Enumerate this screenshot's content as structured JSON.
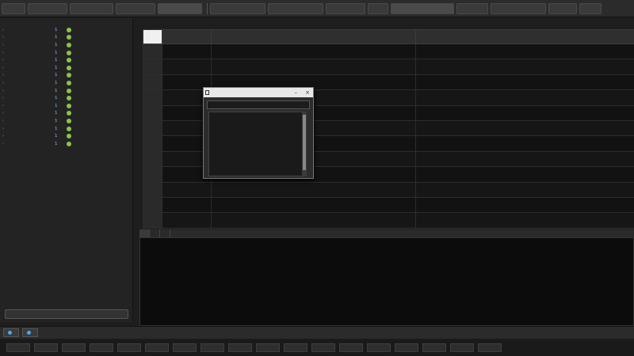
{
  "toolbar": {
    "buttons": [
      "",
      "",
      "",
      "",
      "",
      "",
      "",
      "",
      "",
      "",
      "",
      ""
    ],
    "right_buttons": [
      "",
      "",
      ""
    ]
  },
  "sidebar": {
    "items": [
      {
        "name": "",
        "num": "1"
      },
      {
        "name": "",
        "num": "1"
      },
      {
        "name": "",
        "num": "1"
      },
      {
        "name": "",
        "num": "1"
      },
      {
        "name": "",
        "num": "1"
      },
      {
        "name": "",
        "num": "1"
      },
      {
        "name": "",
        "num": "1"
      },
      {
        "name": "",
        "num": "1"
      },
      {
        "name": "",
        "num": "1"
      },
      {
        "name": "",
        "num": "1"
      },
      {
        "name": "",
        "num": "1"
      },
      {
        "name": "",
        "num": "1"
      },
      {
        "name": "",
        "num": "1"
      },
      {
        "name": "",
        "num": "1"
      },
      {
        "name": "",
        "num": "1"
      },
      {
        "name": "",
        "num": "1"
      }
    ],
    "footer_button": ""
  },
  "main": {
    "breadcrumb": "",
    "columns": [
      "",
      "",
      "",
      ""
    ],
    "rows": [
      [
        "",
        "",
        "",
        ""
      ],
      [
        "",
        "",
        "",
        ""
      ],
      [
        "",
        "",
        "",
        ""
      ],
      [
        "",
        "",
        "",
        ""
      ],
      [
        "",
        "",
        "",
        ""
      ],
      [
        "",
        "",
        "",
        ""
      ],
      [
        "",
        "",
        "",
        ""
      ],
      [
        "",
        "",
        "",
        ""
      ],
      [
        "",
        "",
        "",
        ""
      ],
      [
        "",
        "",
        "",
        ""
      ],
      [
        "",
        "",
        "",
        ""
      ],
      [
        "",
        "",
        "",
        ""
      ]
    ]
  },
  "popup": {
    "title": "",
    "search_placeholder": "",
    "items": [
      "",
      "",
      "",
      "",
      "",
      "",
      "",
      "",
      "",
      ""
    ]
  },
  "output": {
    "tabs": [
      "",
      "",
      ""
    ],
    "lines": [
      "",
      "",
      "",
      "",
      "",
      "",
      "",
      "",
      "",
      "",
      "",
      "",
      "",
      ""
    ]
  },
  "status": {
    "btn1": "",
    "btn2": "",
    "right": ""
  },
  "bottombar": {
    "label": ""
  }
}
